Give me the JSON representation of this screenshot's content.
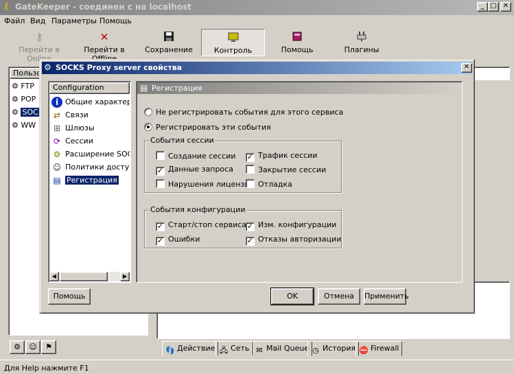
{
  "window": {
    "title": "GateKeeper - соединен с на localhost",
    "minimize": "_",
    "maximize": "□",
    "close": "✕"
  },
  "menu": [
    "Файл",
    "Вид",
    "Параметры",
    "Помощь"
  ],
  "toolbar": {
    "buttons": [
      {
        "label": "Перейти в Online",
        "icon": "key-icon",
        "enabled": false
      },
      {
        "label": "Перейти в Offline",
        "icon": "key-cross-icon",
        "enabled": true
      },
      {
        "label": "Сохранение",
        "icon": "floppy-icon",
        "enabled": true
      },
      {
        "label": "Контроль",
        "icon": "monitor-icon",
        "enabled": true,
        "pressed": true
      },
      {
        "label": "Помощь",
        "icon": "help-book-icon",
        "enabled": true
      },
      {
        "label": "Плагины",
        "icon": "plug-icon",
        "enabled": true
      }
    ]
  },
  "left_panel": {
    "header": "Пользо",
    "items": [
      "FTP",
      "POP",
      "SOC",
      "WW"
    ],
    "selected_index": 2
  },
  "dialog": {
    "title": "SOCKS Proxy server свойства",
    "close": "✕",
    "tree": {
      "header": "Configuration",
      "items": [
        {
          "label": "Общие характеристики",
          "icon": "info-icon"
        },
        {
          "label": "Связи",
          "icon": "link-icon"
        },
        {
          "label": "Шлюзы",
          "icon": "gateway-icon"
        },
        {
          "label": "Сессии",
          "icon": "session-icon"
        },
        {
          "label": "Расширение SOCKS",
          "icon": "extension-icon"
        },
        {
          "label": "Политики доступа",
          "icon": "policy-icon"
        },
        {
          "label": "Регистрация",
          "icon": "document-icon"
        }
      ],
      "selected_index": 6
    },
    "section_title": "Регистрация",
    "radio": [
      {
        "label": "Не регистрировать события для этого сервиса",
        "checked": false
      },
      {
        "label": "Регистрировать эти события",
        "checked": true
      }
    ],
    "session_group": {
      "title": "События сессии",
      "items": [
        {
          "label": "Создание сессии",
          "checked": false
        },
        {
          "label": "Трафик сессии",
          "checked": true
        },
        {
          "label": "Данные запроса",
          "checked": true
        },
        {
          "label": "Закрытие сессии",
          "checked": false
        },
        {
          "label": "Нарушения лицензии",
          "checked": false
        },
        {
          "label": "Отладка",
          "checked": false
        }
      ]
    },
    "config_group": {
      "title": "События конфигурации",
      "items": [
        {
          "label": "Старт/стоп сервиса",
          "checked": true
        },
        {
          "label": "Изм. конфигурации",
          "checked": true
        },
        {
          "label": "Ошибки",
          "checked": true
        },
        {
          "label": "Отказы авторизации",
          "checked": true
        }
      ]
    },
    "buttons": {
      "help": "Помощь",
      "ok": "OK",
      "cancel": "Отмена",
      "apply": "Применить"
    }
  },
  "bottom_tabs": [
    "Действие",
    "Сеть",
    "Mail Queue",
    "История",
    "Firewall"
  ],
  "status": "Для Help нажмите F1"
}
